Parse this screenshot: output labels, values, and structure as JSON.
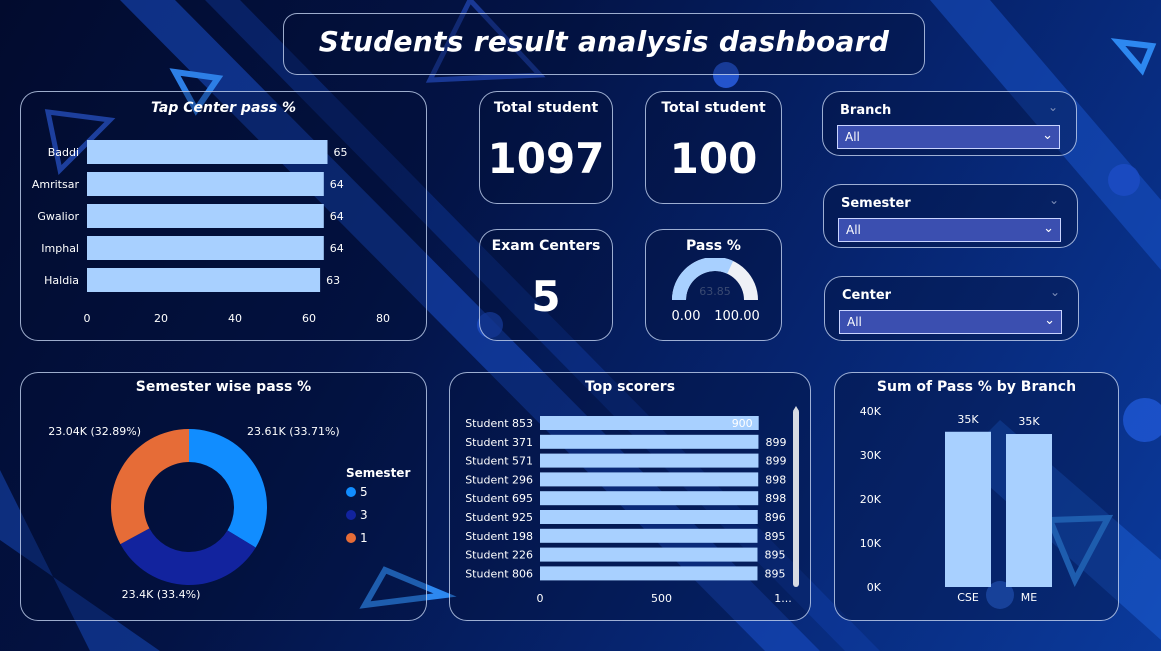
{
  "dashboard": {
    "title": "Students result analysis dashboard"
  },
  "kpis": {
    "total_students": {
      "label": "Total student",
      "value": "1097"
    },
    "total_students_2": {
      "label": "Total student",
      "value": "100"
    },
    "exam_centers": {
      "label": "Exam Centers",
      "value": "5"
    }
  },
  "pass_gauge": {
    "label": "Pass %",
    "value": 63.85,
    "value_text": "63.85",
    "min_text": "0.00",
    "max_text": "100.00",
    "min": 0,
    "max": 100
  },
  "slicers": {
    "branch": {
      "label": "Branch",
      "selected": "All"
    },
    "semester": {
      "label": "Semester",
      "selected": "All"
    },
    "center": {
      "label": "Center",
      "selected": "All"
    }
  },
  "colors": {
    "bar": "#a8d0ff",
    "slice_5": "#118dff",
    "slice_3": "#12239e",
    "slice_1": "#e66c37"
  },
  "chart_data": [
    {
      "id": "tap_center",
      "type": "bar",
      "orientation": "horizontal",
      "title": "Tap Center pass %",
      "categories": [
        "Baddi",
        "Amritsar",
        "Gwalior",
        "Imphal",
        "Haldia"
      ],
      "values": [
        65,
        64,
        64,
        64,
        63
      ],
      "xlim": [
        0,
        80
      ],
      "xticks": [
        "0",
        "20",
        "40",
        "60",
        "80"
      ]
    },
    {
      "id": "semester_pass",
      "type": "pie",
      "title": "Semester wise pass %",
      "legend_title": "Semester",
      "legend_position": "right",
      "slices": [
        {
          "name": "5",
          "value": 23610,
          "label": "23.61K (33.71%)",
          "color": "#118dff"
        },
        {
          "name": "3",
          "value": 23400,
          "label": "23.4K (33.4%)",
          "color": "#12239e"
        },
        {
          "name": "1",
          "value": 23040,
          "label": "23.04K (32.89%)",
          "color": "#e66c37"
        }
      ]
    },
    {
      "id": "top_scorers",
      "type": "bar",
      "orientation": "horizontal",
      "title": "Top scorers",
      "categories": [
        "Student 853",
        "Student 371",
        "Student 571",
        "Student 296",
        "Student 695",
        "Student 925",
        "Student 198",
        "Student 226",
        "Student 806"
      ],
      "values": [
        900,
        899,
        899,
        898,
        898,
        896,
        895,
        895,
        895
      ],
      "xlim": [
        0,
        1000
      ],
      "xticks": [
        "0",
        "500",
        "1..."
      ]
    },
    {
      "id": "branch_pass",
      "type": "bar",
      "title": "Sum of Pass % by Branch",
      "categories": [
        "CSE",
        "ME"
      ],
      "values": [
        35280,
        34770
      ],
      "data_labels": [
        "35K",
        "35K"
      ],
      "ylim": [
        0,
        40000
      ],
      "yticks": [
        "0K",
        "10K",
        "20K",
        "30K",
        "40K"
      ]
    }
  ]
}
